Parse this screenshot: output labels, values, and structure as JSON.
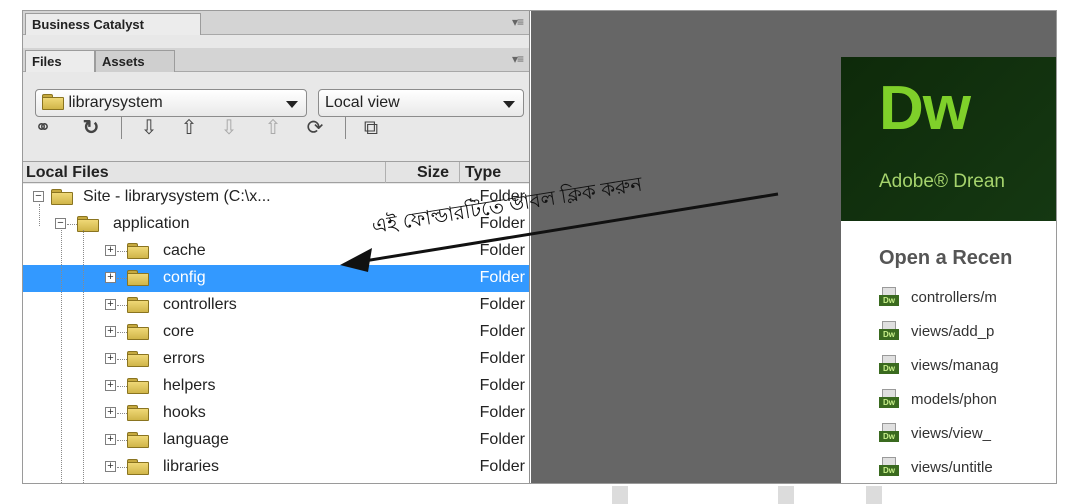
{
  "business_catalyst_tab": "Business Catalyst",
  "files_tabs": [
    "Files",
    "Assets"
  ],
  "site_select": "librarysystem",
  "view_select": "Local view",
  "columns": {
    "local_files": "Local Files",
    "size": "Size",
    "type": "Type"
  },
  "tree": [
    {
      "name": "Site - librarysystem (C:\\x...",
      "type": "Folder",
      "level": 0,
      "expander": "−",
      "selected": false
    },
    {
      "name": "application",
      "type": "Folder",
      "level": 1,
      "expander": "−",
      "selected": false
    },
    {
      "name": "cache",
      "type": "Folder",
      "level": 2,
      "expander": "+",
      "selected": false
    },
    {
      "name": "config",
      "type": "Folder",
      "level": 2,
      "expander": "+",
      "selected": true
    },
    {
      "name": "controllers",
      "type": "Folder",
      "level": 2,
      "expander": "+",
      "selected": false
    },
    {
      "name": "core",
      "type": "Folder",
      "level": 2,
      "expander": "+",
      "selected": false
    },
    {
      "name": "errors",
      "type": "Folder",
      "level": 2,
      "expander": "+",
      "selected": false
    },
    {
      "name": "helpers",
      "type": "Folder",
      "level": 2,
      "expander": "+",
      "selected": false
    },
    {
      "name": "hooks",
      "type": "Folder",
      "level": 2,
      "expander": "+",
      "selected": false
    },
    {
      "name": "language",
      "type": "Folder",
      "level": 2,
      "expander": "+",
      "selected": false
    },
    {
      "name": "libraries",
      "type": "Folder",
      "level": 2,
      "expander": "+",
      "selected": false
    }
  ],
  "welcome": {
    "logo": "Dw",
    "subtitle": "Adobe® Drean",
    "recent_title": "Open a Recen",
    "icon_label": "Dw",
    "recent_files": [
      "controllers/m",
      "views/add_p",
      "views/manag",
      "models/phon",
      "views/view_",
      "views/untitle"
    ]
  },
  "annotation": "এই ফোল্ডারটিতে ডাবল ক্লিক করুন",
  "colors": {
    "selection": "#3399ff",
    "dw_green": "#7fd02a",
    "dw_bg": "#0e2a0a"
  }
}
